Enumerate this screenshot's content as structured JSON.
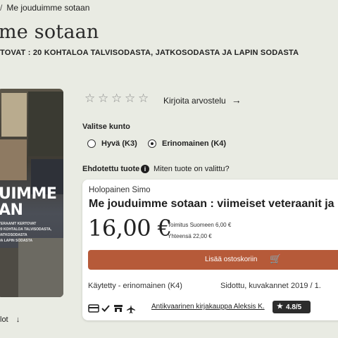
{
  "breadcrumb": {
    "separator": "/",
    "current": "Me jouduimme sotaan"
  },
  "product": {
    "title": "me sotaan",
    "subtitle": "TOVAT : 20 KOHTALOA TALVISODASTA, JATKOSODASTA JA LAPIN SODASTA",
    "cover": {
      "title_line1": "UIMME",
      "title_line2": "AN",
      "sub_line1": "TERAANIT KERTOVAT",
      "sub_line2": "20 KOHTALOA TALVISODASTA,",
      "sub_line3": "JATKOSODASTA",
      "sub_line4": "JA LAPIN SODASTA"
    }
  },
  "reviews": {
    "stars_filled": 0,
    "stars_total": 5,
    "write_label": "Kirjoita arvostelu",
    "arrow": "→"
  },
  "condition": {
    "label": "Valitse kunto",
    "options": [
      {
        "label": "Hyvä (K3)",
        "selected": false
      },
      {
        "label": "Erinomainen (K4)",
        "selected": true
      }
    ]
  },
  "suggested": {
    "label": "Ehdotettu tuote",
    "info_icon": "i",
    "info_text": "Miten tuote on valittu?"
  },
  "offer": {
    "author": "Holopainen Simo",
    "title": "Me jouduimme sotaan : viimeiset veteraanit ja lo",
    "price": "16,00 €",
    "shipping": "Toimitus Suomeen 6,00 €",
    "total": "Yhteensä 22,00 €",
    "cart_label": "Lisää ostoskoriin",
    "cart_icon": "🛒",
    "condition": "Käytetty - erinomainen (K4)",
    "binding": "Sidottu, kuvakannet",
    "year": "2019 / 1.",
    "seller": "Antikvaarinen kirjakauppa Aleksis K.",
    "rating_star": "★",
    "rating": "4.8/5"
  },
  "more": {
    "label": "lot",
    "arrow": "↓"
  },
  "colors": {
    "background": "#e9ebe3",
    "accent": "#b65a39",
    "badge": "#2c2c2c"
  }
}
